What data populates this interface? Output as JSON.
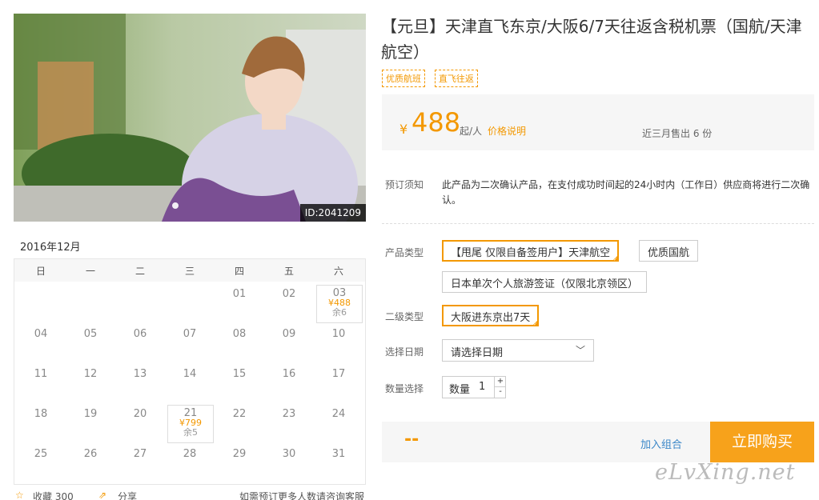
{
  "photo": {
    "id_badge": "ID:2041209"
  },
  "calendar": {
    "month": "2016年12月",
    "weekdays": [
      "日",
      "一",
      "二",
      "三",
      "四",
      "五",
      "六"
    ],
    "week1": [
      "01",
      "02",
      "03"
    ],
    "week2": [
      "04",
      "05",
      "06",
      "07",
      "08",
      "09",
      "10"
    ],
    "week3": [
      "11",
      "12",
      "13",
      "14",
      "15",
      "16",
      "17"
    ],
    "week4": [
      "18",
      "19",
      "20",
      "21",
      "22",
      "23",
      "24"
    ],
    "week5": [
      "25",
      "26",
      "27",
      "28",
      "29",
      "30",
      "31"
    ],
    "special": {
      "d03": {
        "price": "¥488",
        "remain": "余6"
      },
      "d21": {
        "price": "¥799",
        "remain": "余5"
      }
    }
  },
  "bottom": {
    "favorite": "收藏 300",
    "share": "分享",
    "note": "如需预订更多人数请咨询客服"
  },
  "product": {
    "title": "【元旦】天津直飞东京/大阪6/7天往返含税机票（国航/天津航空）",
    "tags": [
      "优质航班",
      "直飞往返"
    ]
  },
  "price": {
    "currency": "¥",
    "amount": "488",
    "unit": "起/人",
    "explain": "价格说明",
    "sold": "近三月售出 6 份"
  },
  "notice": {
    "label": "预订须知",
    "text": "此产品为二次确认产品，在支付成功时间起的24小时内（工作日）供应商将进行二次确认。"
  },
  "options": {
    "type_label": "产品类型",
    "type_options": [
      "【甩尾 仅限自备签用户】天津航空",
      "优质国航",
      "日本单次个人旅游签证（仅限北京领区）"
    ],
    "sub_label": "二级类型",
    "sub_options": [
      "大阪进东京出7天"
    ],
    "date_label": "选择日期",
    "date_placeholder": "请选择日期",
    "qty_label": "数量选择",
    "qty_prefix": "数量",
    "qty_value": "1",
    "plus": "+",
    "minus": "-"
  },
  "action": {
    "total": "--",
    "combo": "加入组合",
    "buy": "立即购买"
  },
  "watermark": "eLvXing.net",
  "colors": {
    "accent": "#f39800",
    "link": "#3b87c8"
  }
}
